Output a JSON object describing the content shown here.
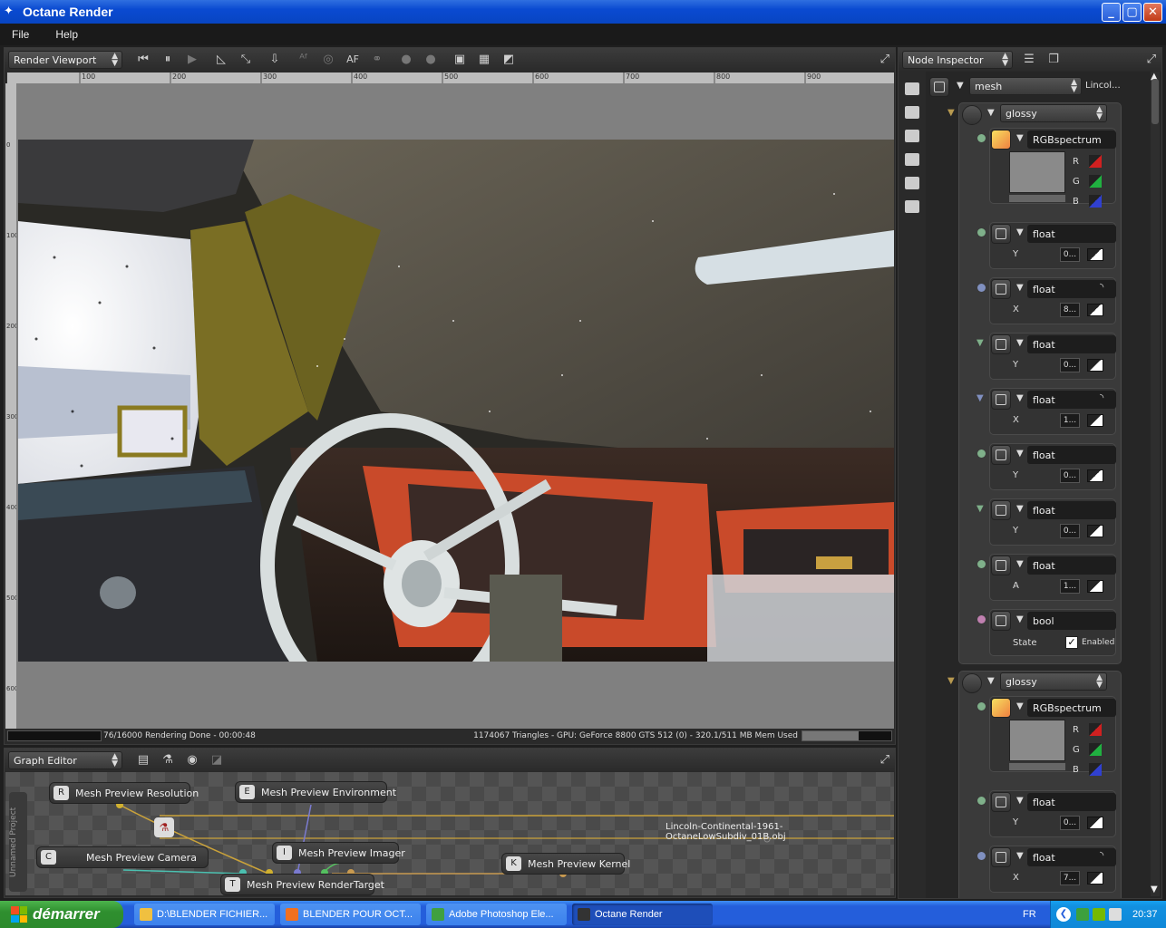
{
  "window": {
    "title": "Octane Render",
    "buttons": [
      "_",
      "▢",
      "✕"
    ]
  },
  "menu": [
    "File",
    "Help"
  ],
  "render_viewport": {
    "mode_label": "Render Viewport",
    "ruler_ticks": [
      "100",
      "200",
      "300",
      "400",
      "500",
      "600",
      "700",
      "800",
      "900"
    ],
    "ruler_vticks": [
      "0",
      "100",
      "200",
      "300",
      "400",
      "500",
      "600"
    ],
    "toolbar_icons": [
      "rewind-icon",
      "pause-icon",
      "play-icon",
      "region-icon",
      "fit-icon",
      "export-icon",
      "autofocus-icon",
      "pick-icon",
      "af-icon",
      "material-pick-icon",
      "lock-icon",
      "lock2-icon",
      "alpha-icon",
      "checker-icon",
      "checker2-icon"
    ],
    "af_label": "AF"
  },
  "status": {
    "left": "76/16000 Rendering Done - 00:00:48",
    "right": "1174067 Triangles - GPU: GeForce 8800 GTS 512 (0) - 320.1/511 MB Mem Used",
    "memory_fraction": 0.63
  },
  "graph_editor": {
    "label": "Graph Editor",
    "project_tab": "Unnamed Project",
    "nodes": [
      {
        "label": "Mesh Preview Resolution",
        "icon": "R"
      },
      {
        "label": "Mesh Preview Environment",
        "icon": "E"
      },
      {
        "label": "Mesh Preview Camera",
        "icon": "C"
      },
      {
        "label": "Mesh Preview Imager",
        "icon": "I"
      },
      {
        "label": "Mesh Preview RenderTarget",
        "icon": "T"
      },
      {
        "label": "Mesh Preview Kernel",
        "icon": "K"
      }
    ],
    "mesh_label": "Lincoln-Continental-1961-OctaneLowSubdiv_01B.obj"
  },
  "inspector": {
    "label": "Node Inspector",
    "mesh_dropdown": "mesh",
    "mesh_name": "Lincol...",
    "material1": "glossy",
    "material2": "glossy",
    "rgb_label": "RGBspectrum",
    "rgb_channels": [
      "R",
      "G",
      "B"
    ],
    "floats": [
      {
        "name": "float",
        "axis": "Y",
        "value": "0..."
      },
      {
        "name": "float",
        "axis": "X",
        "value": "8..."
      },
      {
        "name": "float",
        "axis": "Y",
        "value": "0..."
      },
      {
        "name": "float",
        "axis": "X",
        "value": "1..."
      },
      {
        "name": "float",
        "axis": "Y",
        "value": "0..."
      },
      {
        "name": "float",
        "axis": "Y",
        "value": "0..."
      },
      {
        "name": "float",
        "axis": "A",
        "value": "1..."
      }
    ],
    "bool": {
      "name": "bool",
      "label": "State",
      "value_label": "Enabled",
      "checked": true
    },
    "floats2": [
      {
        "name": "float",
        "axis": "Y",
        "value": "0..."
      },
      {
        "name": "float",
        "axis": "X",
        "value": "7..."
      }
    ]
  },
  "taskbar": {
    "start": "démarrer",
    "tasks": [
      {
        "label": "D:\\BLENDER FICHIER...",
        "color": "#f0c040"
      },
      {
        "label": "BLENDER POUR OCT...",
        "color": "#f07020"
      },
      {
        "label": "Adobe Photoshop Ele...",
        "color": "#40a040"
      },
      {
        "label": "Octane Render",
        "color": "#333333"
      }
    ],
    "lang": "FR",
    "clock": "20:37"
  }
}
